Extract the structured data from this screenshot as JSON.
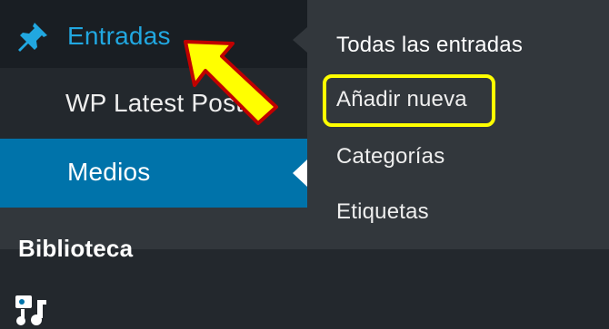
{
  "sidebar": {
    "items": [
      {
        "label": "Entradas",
        "icon": "pin-icon",
        "state": "current"
      },
      {
        "label": "WP Latest Posts",
        "icon": "edit-icon"
      },
      {
        "label": "Medios",
        "icon": "media-icon",
        "state": "hover"
      },
      {
        "label": "Biblioteca",
        "icon": ""
      }
    ]
  },
  "submenu": {
    "items": [
      {
        "label": "Todas las entradas"
      },
      {
        "label": "Añadir nueva",
        "highlighted": true
      },
      {
        "label": "Categorías"
      },
      {
        "label": "Etiquetas"
      }
    ]
  },
  "annotation": {
    "arrow_color": "#ffff00",
    "highlight_color": "#ffff00",
    "arrow_points_to": "Entradas"
  },
  "colors": {
    "sidebar_bg": "#23282d",
    "submenu_bg": "#32373c",
    "current_text": "#21a7e0",
    "active_item_bg": "#0073aa"
  }
}
